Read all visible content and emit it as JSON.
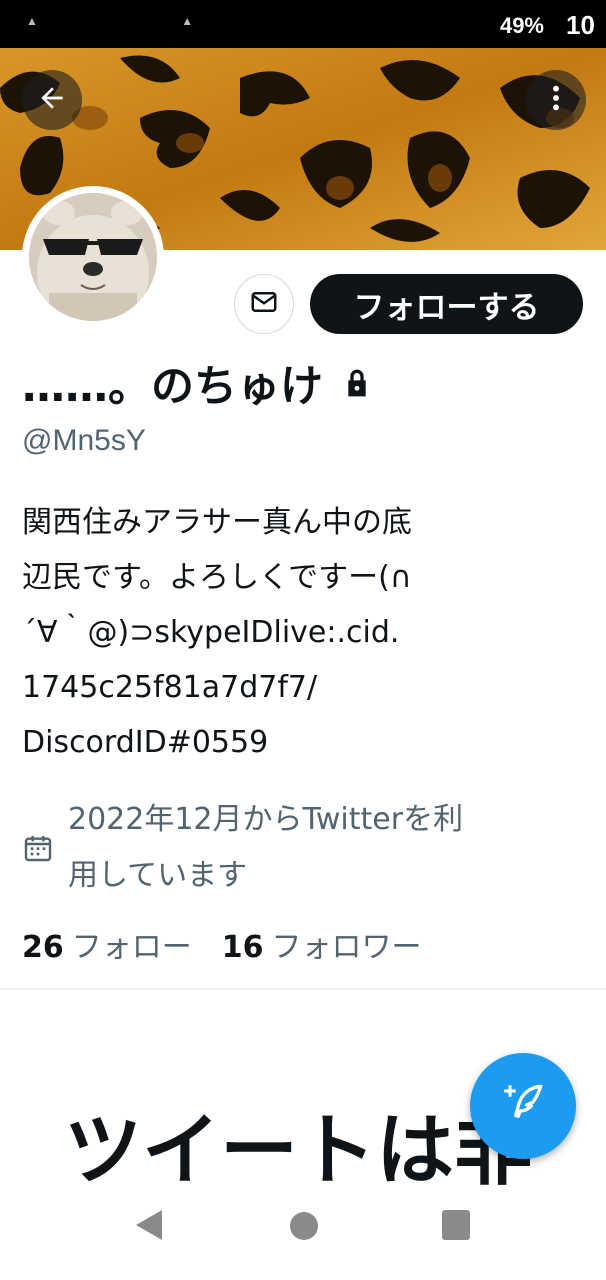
{
  "status_bar": {
    "battery": "49%",
    "clock": "10"
  },
  "header": {
    "back_icon": "arrow-left-icon",
    "more_icon": "more-vertical-icon"
  },
  "profile": {
    "display_name": "……。のちゅけ",
    "protected_icon": "lock-icon",
    "handle": "@Mn5sY",
    "bio_lines": [
      "関西住みアラサー真ん中の底",
      "辺民です。よろしくですー(∩",
      "´∀｀@)⊃skypeIDlive:.cid.",
      "1745c25f81a7d7f7/",
      "DiscordID#0559"
    ],
    "joined_lines": [
      "2022年12月からTwitterを利",
      "用しています"
    ],
    "following_count": "26",
    "following_label": "フォロー",
    "followers_count": "16",
    "followers_label": "フォロワー"
  },
  "actions": {
    "message_icon": "envelope-icon",
    "follow_label": "フォローする"
  },
  "timeline": {
    "empty_heading": "ツイートは非"
  },
  "fab": {
    "icon": "compose-tweet-icon"
  },
  "colors": {
    "primary": "#1d9bf0",
    "text": "#0f1419",
    "secondary_text": "#536471",
    "follow_button_bg": "#0f1419"
  }
}
